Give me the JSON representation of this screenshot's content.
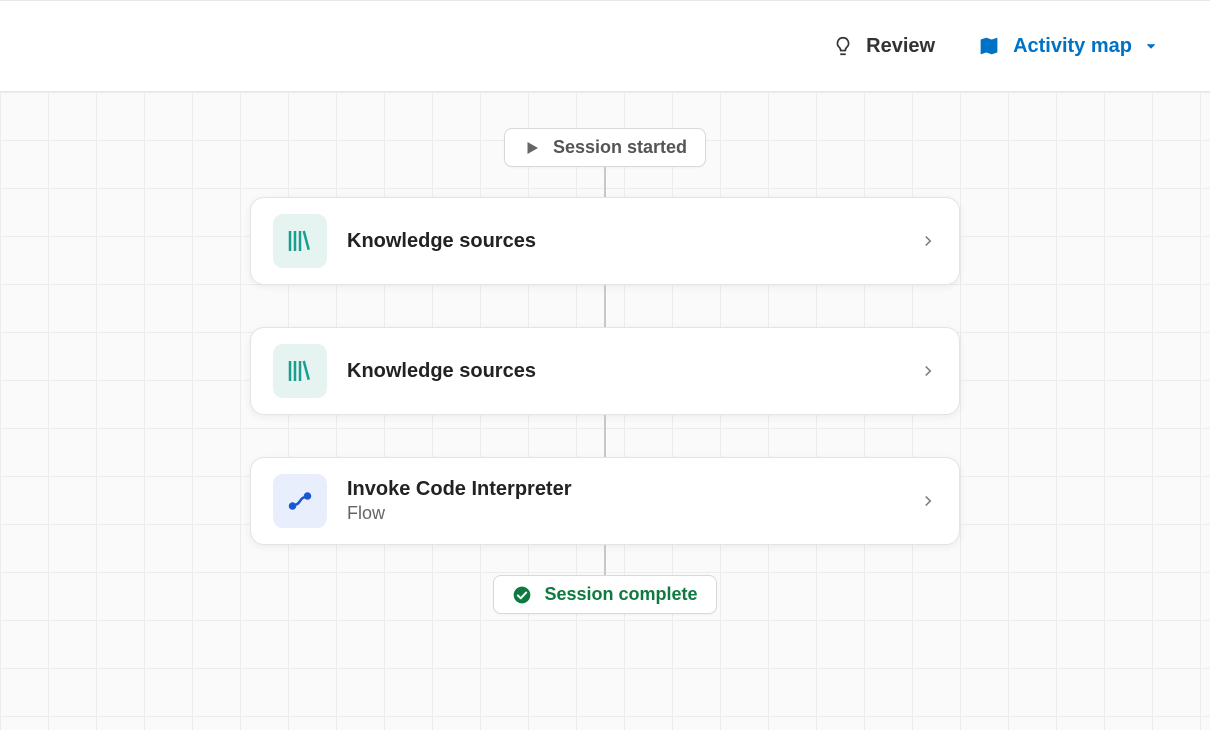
{
  "header": {
    "review_label": "Review",
    "activity_map_label": "Activity map"
  },
  "flow": {
    "start_label": "Session started",
    "end_label": "Session complete",
    "nodes": [
      {
        "title": "Knowledge sources",
        "subtitle": "",
        "icon": "books",
        "icon_bg": "teal"
      },
      {
        "title": "Knowledge sources",
        "subtitle": "",
        "icon": "books",
        "icon_bg": "teal"
      },
      {
        "title": "Invoke Code Interpreter",
        "subtitle": "Flow",
        "icon": "flow",
        "icon_bg": "blue"
      }
    ]
  },
  "colors": {
    "accent": "#0072c6",
    "success": "#0e7a3f",
    "teal": "#1a9e8f"
  }
}
